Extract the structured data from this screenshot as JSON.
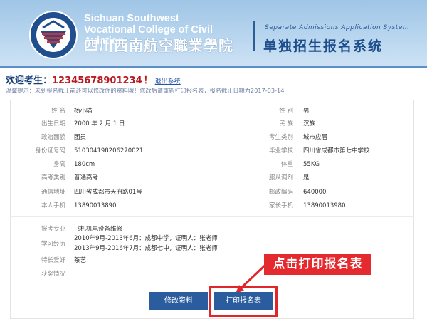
{
  "banner": {
    "en_line1": "Sichuan Southwest",
    "en_line2": "Vocational College of Civil Aviation",
    "cn_name": "四川西南航空職業學院",
    "system_en": "Separate Admissions Application System",
    "system_cn": "单独招生报名系统",
    "brand_color": "#2c5d96"
  },
  "welcome": {
    "prefix": "欢迎考生：",
    "number": "12345678901234",
    "exclaim": "！",
    "logout_label": "退出系统",
    "tip": "温馨提示：未到报名截止前还可以修改你的资料哦！修改后请重新打印报名表，报名截止日期为2017-03-14"
  },
  "left_fields": [
    {
      "label": "姓 名",
      "value": "杨小喵"
    },
    {
      "label": "出生日期",
      "value": "2000 年 2 月 1 日"
    },
    {
      "label": "政治面貌",
      "value": "团员"
    },
    {
      "label": "身份证号码",
      "value": "510304198206270021"
    },
    {
      "label": "身高",
      "value": "180cm"
    },
    {
      "label": "高考类别",
      "value": "普通高考"
    },
    {
      "label": "通信地址",
      "value": "四川省成都市天府路01号"
    },
    {
      "label": "本人手机",
      "value": "13890013890"
    }
  ],
  "right_fields": [
    {
      "label": "性 别",
      "value": "男"
    },
    {
      "label": "民 族",
      "value": "汉族"
    },
    {
      "label": "考生类别",
      "value": "城市应届"
    },
    {
      "label": "毕业学校",
      "value": "四川省成都市第七中学校"
    },
    {
      "label": "体重",
      "value": "55KG"
    },
    {
      "label": "服从调剂",
      "value": "是"
    },
    {
      "label": "邮政编码",
      "value": "640000"
    },
    {
      "label": "家长手机",
      "value": "13890013980"
    }
  ],
  "lower_fields": {
    "major": {
      "label": "报考专业",
      "value": "飞机机电设备维修"
    },
    "study": {
      "label": "学习经历",
      "line1": "2010年9月-2013年6月：成都中学，证明人：张老师",
      "line2": "2013年9月-2016年7月：成都七中，证明人：张老师"
    },
    "hobby": {
      "label": "特长爱好",
      "value": "茶艺"
    },
    "awards": {
      "label": "获奖情况",
      "value": ""
    }
  },
  "buttons": {
    "edit": "修改资料",
    "print": "打印报名表"
  },
  "annotation": {
    "callout": "点击打印报名表",
    "color": "#e0262b"
  }
}
